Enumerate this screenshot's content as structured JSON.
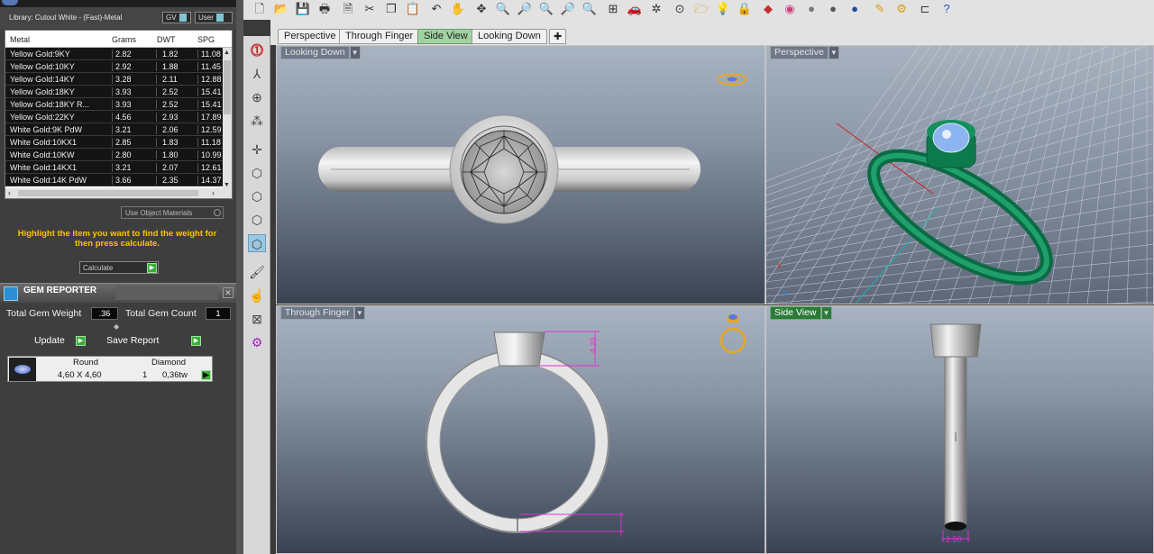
{
  "library": {
    "label": "Library: Cutout White - (Fast)-Metal",
    "gv_btn": "GV",
    "user_btn": "User"
  },
  "metal_table": {
    "headers": [
      "Metal",
      "Grams",
      "DWT",
      "SPG"
    ],
    "rows": [
      [
        "Yellow Gold:9KY",
        "2.82",
        "1.82",
        "11.08"
      ],
      [
        "Yellow Gold:10KY",
        "2.92",
        "1.88",
        "11.45"
      ],
      [
        "Yellow Gold:14KY",
        "3.28",
        "2.11",
        "12.88"
      ],
      [
        "Yellow Gold:18KY",
        "3.93",
        "2.52",
        "15.41"
      ],
      [
        "Yellow Gold:18KY R...",
        "3.93",
        "2.52",
        "15.41"
      ],
      [
        "Yellow Gold:22KY",
        "4.56",
        "2.93",
        "17.89"
      ],
      [
        "White Gold:9K PdW",
        "3.21",
        "2.06",
        "12.59"
      ],
      [
        "White Gold:10KX1",
        "2.85",
        "1.83",
        "11.18"
      ],
      [
        "White Gold:10KW",
        "2.80",
        "1.80",
        "10.99"
      ],
      [
        "White Gold:14KX1",
        "3.21",
        "2.07",
        "12.61"
      ],
      [
        "White Gold:14K PdW",
        "3.66",
        "2.35",
        "14.37"
      ]
    ]
  },
  "use_object_materials": "Use Object Materials",
  "hint": "Highlight the item you want to find the weight for then press calculate.",
  "calculate_label": "Calculate",
  "gem_reporter": {
    "title": "GEM REPORTER",
    "total_gem_weight_label": "Total Gem Weight",
    "total_gem_weight": ".36",
    "total_gem_count_label": "Total Gem Count",
    "total_gem_count": "1",
    "update_label": "Update",
    "save_report_label": "Save Report",
    "gem": {
      "shape": "Round",
      "material": "Diamond",
      "size": "4,60 X 4,60",
      "count": "1",
      "weight": "0,36tw"
    }
  },
  "view_tabs": [
    "Perspective",
    "Through Finger",
    "Side View",
    "Looking Down"
  ],
  "active_tab": "Side View",
  "viewports": {
    "top_left": "Looking Down",
    "top_right": "Perspective",
    "bottom_left": "Through Finger",
    "bottom_right": "Side View"
  },
  "dimensions": {
    "head_height": "4.20",
    "shank_width_bottom": "2.50"
  },
  "colors": {
    "ring_green": "#0b7a4e",
    "dimension_magenta": "#e030d8",
    "active_tab": "#9fd3a0",
    "hint_text": "#ffc400"
  }
}
